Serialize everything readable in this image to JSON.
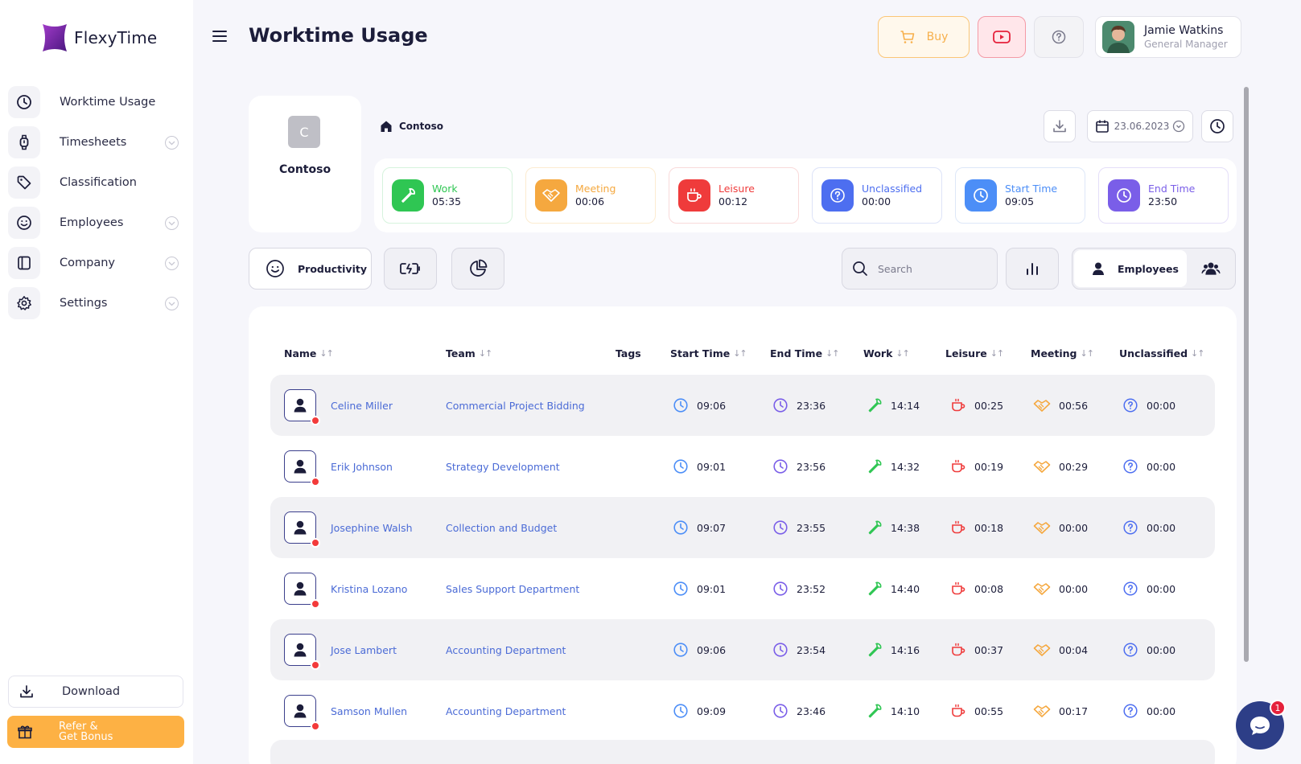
{
  "app": {
    "name": "FlexyTime"
  },
  "sidebar": {
    "items": [
      {
        "label": "Worktime Usage",
        "icon": "clock-icon",
        "expandable": false
      },
      {
        "label": "Timesheets",
        "icon": "watch-icon",
        "expandable": true
      },
      {
        "label": "Classification",
        "icon": "tag-icon",
        "expandable": false
      },
      {
        "label": "Employees",
        "icon": "smiley-icon",
        "expandable": true
      },
      {
        "label": "Company",
        "icon": "panel-icon",
        "expandable": true
      },
      {
        "label": "Settings",
        "icon": "gear-icon",
        "expandable": true
      }
    ],
    "download_label": "Download",
    "refer_line1": "Refer &",
    "refer_line2": "Get Bonus"
  },
  "header": {
    "title": "Worktime Usage",
    "buy_label": "Buy",
    "user": {
      "name": "Jamie Watkins",
      "role": "General Manager"
    }
  },
  "company": {
    "initial": "C",
    "name": "Contoso",
    "breadcrumb": "Contoso",
    "date": "23.06.2023"
  },
  "stats": [
    {
      "label": "Work",
      "value": "05:35",
      "color": "#2fc653",
      "bg": "#ffffff",
      "border": "#d6f3dd",
      "icon": "wrench-icon"
    },
    {
      "label": "Meeting",
      "value": "00:06",
      "color": "#f5a83f",
      "bg": "#ffffff",
      "border": "#fcebd0",
      "icon": "handshake-icon"
    },
    {
      "label": "Leisure",
      "value": "00:12",
      "color": "#ef3b3b",
      "bg": "#ffffff",
      "border": "#f9dada",
      "icon": "coffee-icon"
    },
    {
      "label": "Unclassified",
      "value": "00:00",
      "color": "#4d6ef0",
      "bg": "#ffffff",
      "border": "#dde3f8",
      "icon": "question-icon"
    },
    {
      "label": "Start Time",
      "value": "09:05",
      "color": "#4c8ef7",
      "bg": "#ffffff",
      "border": "#dde7f8",
      "icon": "clock-icon"
    },
    {
      "label": "End Time",
      "value": "23:50",
      "color": "#7a5ee8",
      "bg": "#ffffff",
      "border": "#e4def8",
      "icon": "clock-icon"
    }
  ],
  "toolbar": {
    "productivity_label": "Productivity",
    "search_placeholder": "Search",
    "employees_label": "Employees"
  },
  "table": {
    "columns": [
      "Name",
      "Team",
      "Tags",
      "Start Time",
      "End Time",
      "Work",
      "Leisure",
      "Meeting",
      "Unclassified"
    ],
    "rows": [
      {
        "name": "Celine Miller",
        "team": "Commercial Project Bidding",
        "start": "09:06",
        "end": "23:36",
        "work": "14:14",
        "leisure": "00:25",
        "meeting": "00:56",
        "unclassified": "00:00"
      },
      {
        "name": "Erik Johnson",
        "team": "Strategy Development",
        "start": "09:01",
        "end": "23:56",
        "work": "14:32",
        "leisure": "00:19",
        "meeting": "00:29",
        "unclassified": "00:00"
      },
      {
        "name": "Josephine Walsh",
        "team": "Collection and Budget",
        "start": "09:07",
        "end": "23:55",
        "work": "14:38",
        "leisure": "00:18",
        "meeting": "00:00",
        "unclassified": "00:00"
      },
      {
        "name": "Kristina Lozano",
        "team": "Sales Support Department",
        "start": "09:01",
        "end": "23:52",
        "work": "14:40",
        "leisure": "00:08",
        "meeting": "00:00",
        "unclassified": "00:00"
      },
      {
        "name": "Jose Lambert",
        "team": "Accounting Department",
        "start": "09:06",
        "end": "23:54",
        "work": "14:16",
        "leisure": "00:37",
        "meeting": "00:04",
        "unclassified": "00:00"
      },
      {
        "name": "Samson Mullen",
        "team": "Accounting Department",
        "start": "09:09",
        "end": "23:46",
        "work": "14:10",
        "leisure": "00:55",
        "meeting": "00:17",
        "unclassified": "00:00"
      }
    ]
  },
  "chat": {
    "badge": "1"
  }
}
